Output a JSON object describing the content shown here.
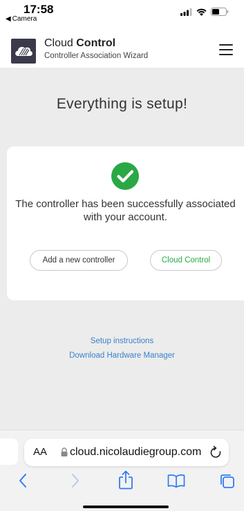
{
  "status_bar": {
    "time": "17:58",
    "back_label": "Camera"
  },
  "header": {
    "title_plain": "Cloud ",
    "title_bold": "Control",
    "subtitle": "Controller Association Wizard"
  },
  "main": {
    "heading": "Everything is setup!",
    "message": "The controller has been successfully associated with your account.",
    "add_controller_label": "Add a new controller",
    "cloud_control_label": "Cloud Control",
    "accent_color": "#2aa846"
  },
  "links": {
    "setup_instructions": "Setup instructions",
    "download_manager": "Download Hardware Manager",
    "link_color": "#3a82c8"
  },
  "browser": {
    "aa_label": "AA",
    "url": "cloud.nicolaudiegroup.com"
  }
}
